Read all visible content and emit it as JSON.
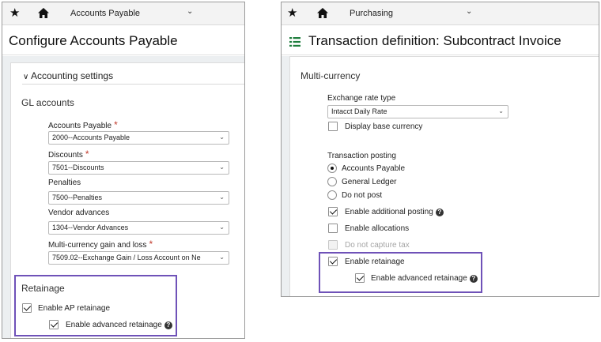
{
  "left": {
    "header": {
      "app_name": "Accounts Payable"
    },
    "page_title": "Configure Accounts Payable",
    "accounting_section": "Accounting settings",
    "gl_heading": "GL accounts",
    "fields": [
      {
        "label": "Accounts Payable",
        "value": "2000--Accounts Payable",
        "required": "*"
      },
      {
        "label": "Discounts",
        "value": "7501--Discounts",
        "required": "*"
      },
      {
        "label": "Penalties",
        "value": "7500--Penalties",
        "required": ""
      },
      {
        "label": "Vendor advances",
        "value": "1304--Vendor Advances",
        "required": ""
      },
      {
        "label": "Multi-currency gain and loss",
        "value": "7509.02--Exchange Gain / Loss Account on Ne",
        "required": "*"
      }
    ],
    "retainage": {
      "heading": "Retainage",
      "enable_ap": "Enable AP retainage",
      "enable_advanced": "Enable advanced retainage"
    }
  },
  "right": {
    "header": {
      "app_name": "Purchasing"
    },
    "page_title": "Transaction definition: Subcontract Invoice",
    "multicurrency_heading": "Multi-currency",
    "exchange_rate_label": "Exchange rate type",
    "exchange_rate_value": "Intacct Daily Rate",
    "display_base_currency": "Display base currency",
    "posting_label": "Transaction posting",
    "posting_options": [
      "Accounts Payable",
      "General Ledger",
      "Do not post"
    ],
    "selected_posting": "Accounts Payable",
    "enable_additional_posting": "Enable additional posting",
    "enable_allocations": "Enable allocations",
    "do_not_capture_tax": "Do not capture tax",
    "enable_retainage": "Enable retainage",
    "enable_advanced_retainage": "Enable advanced retainage"
  },
  "colors": {
    "highlight": "#6f52b8",
    "required": "#c0392b",
    "content_bg": "#eceff1"
  },
  "icons": {
    "favorite": "star-icon",
    "home": "home-icon",
    "menu": "list-icon",
    "help": "help-icon"
  }
}
